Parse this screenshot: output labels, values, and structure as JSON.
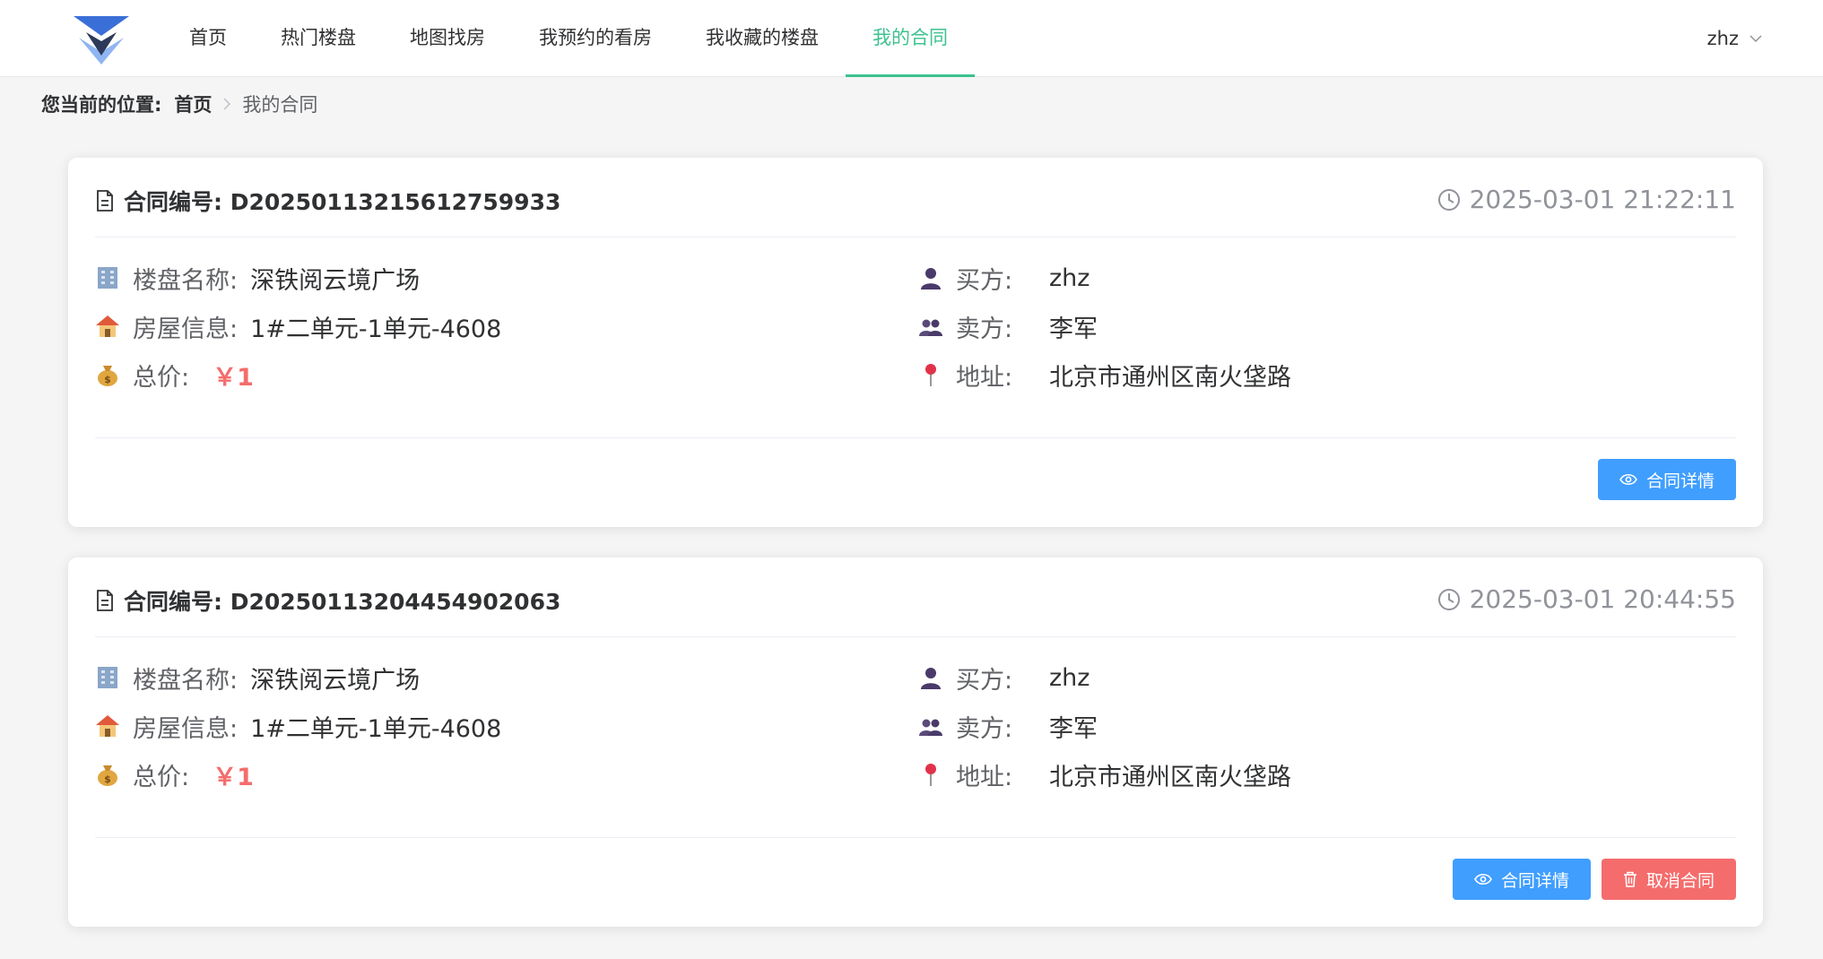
{
  "header": {
    "nav": [
      {
        "label": "首页"
      },
      {
        "label": "热门楼盘"
      },
      {
        "label": "地图找房"
      },
      {
        "label": "我预约的看房"
      },
      {
        "label": "我收藏的楼盘"
      },
      {
        "label": "我的合同"
      }
    ],
    "active_tab": "我的合同",
    "user": {
      "name": "zhz",
      "icon": "chevron-down-icon"
    },
    "colors": {
      "accent": "#3ec28f",
      "logo_dark": "#2d3a5a",
      "logo_light": "#7aa8f0"
    }
  },
  "breadcrumb": {
    "label": "您当前的位置:",
    "home": "首页",
    "current": "我的合同"
  },
  "contracts": [
    {
      "no_label": "合同编号: D20250113215612759933",
      "time": "2025-03-01 21:22:11",
      "building_label": "楼盘名称:",
      "building": "深铁阅云境广场",
      "house_label": "房屋信息:",
      "house": "1#二单元-1单元-4608",
      "price_label": "总价:",
      "price": "￥1",
      "buyer_label": "买方:",
      "buyer": "zhz",
      "seller_label": "卖方:",
      "seller": "李军",
      "address_label": "地址:",
      "address": "北京市通州区南火垡路",
      "detail_button": "合同详情"
    },
    {
      "no_label": "合同编号: D20250113204454902063",
      "time": "2025-03-01 20:44:55",
      "building_label": "楼盘名称:",
      "building": "深铁阅云境广场",
      "house_label": "房屋信息:",
      "house": "1#二单元-1单元-4608",
      "price_label": "总价:",
      "price": "￥1",
      "buyer_label": "买方:",
      "buyer": "zhz",
      "seller_label": "卖方:",
      "seller": "李军",
      "address_label": "地址:",
      "address": "北京市通州区南火垡路",
      "detail_button": "合同详情",
      "cancel_button": "取消合同"
    }
  ],
  "colors": {
    "primary": "#409eff",
    "danger": "#f56c6c",
    "price": "#f56c6c"
  }
}
